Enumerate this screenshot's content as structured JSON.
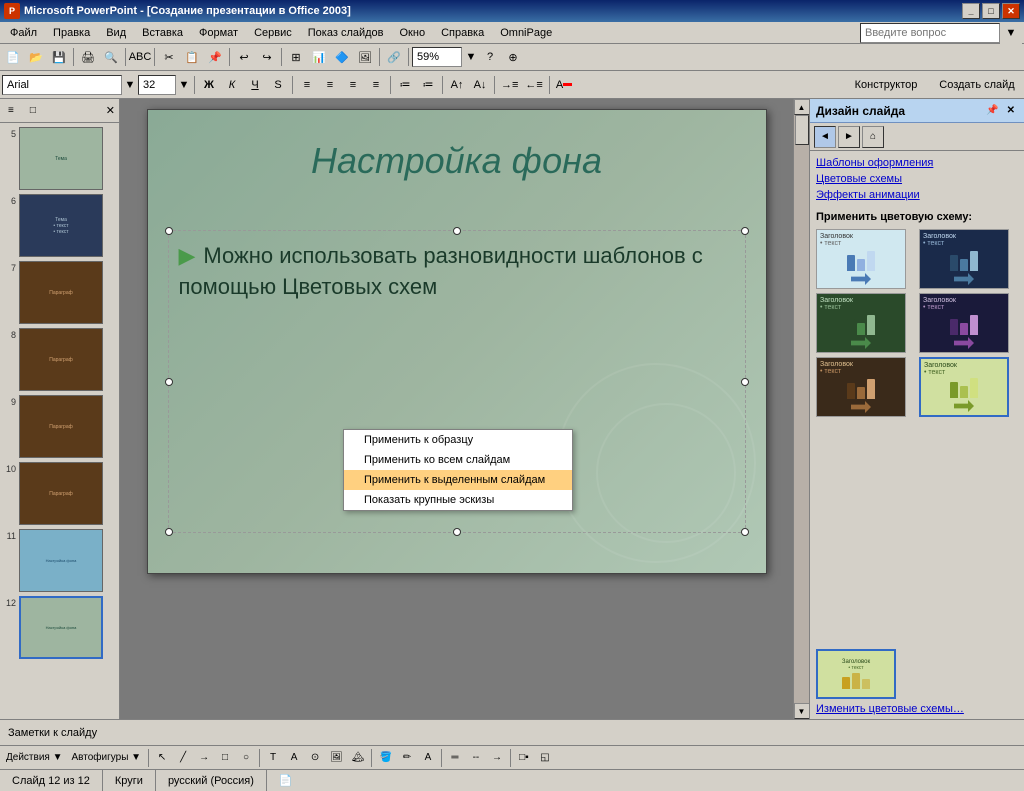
{
  "titleBar": {
    "icon": "PP",
    "title": "Microsoft PowerPoint - [Создание презентации в Office 2003]",
    "buttons": [
      "_",
      "□",
      "✕"
    ]
  },
  "menuBar": {
    "items": [
      "Файл",
      "Правка",
      "Вид",
      "Вставка",
      "Формат",
      "Сервис",
      "Показ слайдов",
      "Окно",
      "Справка",
      "OmniPage"
    ]
  },
  "toolbar1": {
    "zoom": "59%",
    "help_placeholder": "Введите вопрос"
  },
  "toolbar2": {
    "font_name": "Arial",
    "font_size": "32",
    "bold": "Ж",
    "italic": "К",
    "underline": "Ч",
    "shadow": "S",
    "align_btns": [
      "≡",
      "≡",
      "≡",
      "≡"
    ],
    "designer_btn": "Конструктор",
    "new_slide_btn": "Создать слайд"
  },
  "slidePanel": {
    "tabs": [
      "≡",
      "□"
    ],
    "slides": [
      {
        "num": "5",
        "bg": "teal",
        "text": "Тема"
      },
      {
        "num": "6",
        "bg": "dark",
        "text": "Текст"
      },
      {
        "num": "7",
        "bg": "brown",
        "text": "Параграф"
      },
      {
        "num": "8",
        "bg": "brown",
        "text": "Параграф"
      },
      {
        "num": "9",
        "bg": "brown",
        "text": "Параграф"
      },
      {
        "num": "10",
        "bg": "brown",
        "text": "Параграф"
      },
      {
        "num": "11",
        "bg": "highlight",
        "text": "Настройка фона"
      },
      {
        "num": "12",
        "bg": "teal-selected",
        "text": "Настройка фона"
      }
    ]
  },
  "slideCanvas": {
    "title": "Настройка фона",
    "content": "Можно использовать разновидности шаблонов с помощью Цветовых схем"
  },
  "notesBar": {
    "label": "Заметки к слайду"
  },
  "designPanel": {
    "title": "Дизайн слайда",
    "nav_btns": [
      "◄",
      "►",
      "⌂"
    ],
    "links": [
      "Шаблоны оформления",
      "Цветовые схемы",
      "Эффекты анимации"
    ],
    "apply_label": "Применить цветовую схему:",
    "schemes": [
      {
        "label": "Заголовок",
        "text_label": "• текст",
        "bar_colors": [
          "#4a7ab5",
          "#90b0e0",
          "#c0d8f0"
        ],
        "bg": "#d0e8f0",
        "arrow_color": "#4a7ab5"
      },
      {
        "label": "Заголовок",
        "text_label": "• текст",
        "bar_colors": [
          "#2a4a6a",
          "#4a7aa0",
          "#90b8d0"
        ],
        "bg": "#1a2a4a",
        "dark": true,
        "arrow_color": "#4a7aa0"
      },
      {
        "label": "Заголовок",
        "text_label": "• текст",
        "bar_colors": [
          "#2a4a2a",
          "#4a8a4a",
          "#90b890"
        ],
        "bg": "#2a4a2a",
        "dark": true,
        "arrow_color": "#4a8a4a"
      },
      {
        "label": "Заголовок",
        "text_label": "• текст",
        "bar_colors": [
          "#4a2a6a",
          "#8a4aa0",
          "#c090d0"
        ],
        "bg": "#1a1a3a",
        "dark": true,
        "arrow_color": "#8a4aa0"
      },
      {
        "label": "Заголовок",
        "text_label": "• текст",
        "bar_colors": [
          "#5a3a1a",
          "#9a6a3a",
          "#d0a070"
        ],
        "bg": "#3a2a1a",
        "dark": true,
        "arrow_color": "#9a6a3a"
      },
      {
        "label": "Заголовок",
        "text_label": "• текст",
        "bar_colors": [
          "#7a9a2a",
          "#aac050",
          "#d0e080"
        ],
        "bg": "#d0e0a0",
        "selected": true,
        "arrow_color": "#7a9a2a"
      }
    ],
    "bottom_link": "Изменить цветовые схемы…"
  },
  "contextMenu": {
    "items": [
      {
        "label": "Применить к образцу",
        "highlighted": false
      },
      {
        "label": "Применить ко всем слайдам",
        "highlighted": false
      },
      {
        "label": "Применить к выделенным слайдам",
        "highlighted": true
      },
      {
        "label": "Показать крупные эскизы",
        "highlighted": false
      }
    ]
  },
  "statusBar": {
    "slide_info": "Слайд 12 из 12",
    "shape_info": "Круги",
    "language": "русский (Россия)"
  },
  "bottomToolbar": {
    "actions_btn": "Действия ▼",
    "autoshapes_btn": "Автофигуры ▼"
  }
}
